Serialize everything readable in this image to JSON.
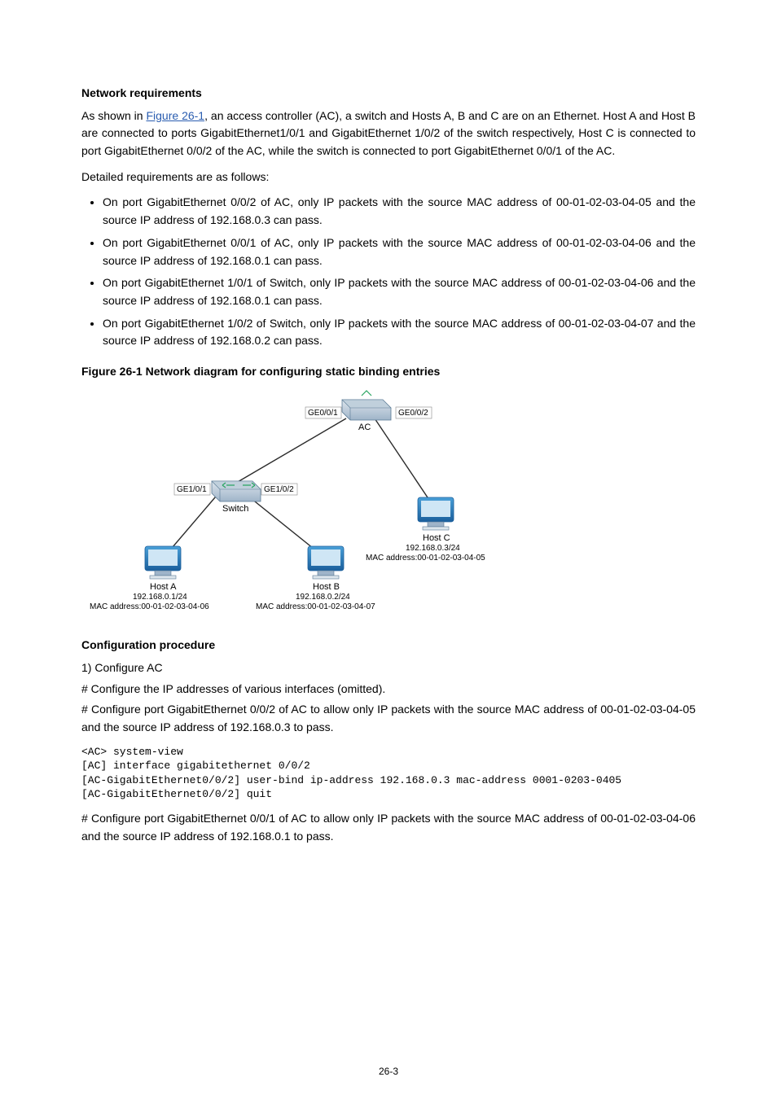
{
  "headings": {
    "network_requirements": "Network requirements",
    "configuration_procedure": "Configuration procedure"
  },
  "intro": {
    "pre_link": "As shown in ",
    "link": "Figure 26-1",
    "post_link": ", an access controller (AC), a switch and Hosts A, B and C are on an Ethernet. Host A and Host B are connected to ports GigabitEthernet1/0/1 and GigabitEthernet 1/0/2 of the switch respectively, Host C is connected to port GigabitEthernet 0/0/2 of the AC, while the switch is connected to port GigabitEthernet 0/0/1 of the AC."
  },
  "detailed_line": "Detailed requirements are as follows:",
  "bullets": [
    "On port GigabitEthernet 0/0/2 of AC, only IP packets with the source MAC address of 00-01-02-03-04-05 and the source IP address of 192.168.0.3 can pass.",
    "On port GigabitEthernet 0/0/1 of AC, only IP packets with the source MAC address of 00-01-02-03-04-06 and the source IP address of 192.168.0.1 can pass.",
    "On port GigabitEthernet 1/0/1 of Switch, only IP packets with the source MAC address of 00-01-02-03-04-06 and the source IP address of 192.168.0.1 can pass.",
    "On port GigabitEthernet 1/0/2 of Switch, only IP packets with the source MAC address of 00-01-02-03-04-07 and the source IP address of 192.168.0.2 can pass."
  ],
  "figure": {
    "caption_prefix": "Figure 26-1",
    "caption_text": " Network diagram for configuring static binding entries",
    "labels": {
      "ge001": "GE0/0/1",
      "ge002": "GE0/0/2",
      "ac": "AC",
      "ge101": "GE1/0/1",
      "ge102": "GE1/0/2",
      "switch": "Switch",
      "hostA_name": "Host A",
      "hostA_ip": "192.168.0.1/24",
      "hostA_mac": "MAC address:00-01-02-03-04-06",
      "hostB_name": "Host B",
      "hostB_ip": "192.168.0.2/24",
      "hostB_mac": "MAC address:00-01-02-03-04-07",
      "hostC_name": "Host C",
      "hostC_ip": "192.168.0.3/24",
      "hostC_mac": "MAC address:00-01-02-03-04-05"
    }
  },
  "procedure": {
    "step1_label": "1)    Configure AC",
    "line1": "# Configure the IP addresses of various interfaces (omitted).",
    "line2": "# Configure port GigabitEthernet 0/0/2 of AC to allow only IP packets with the source MAC address of 00-01-02-03-04-05 and the source IP address of 192.168.0.3 to pass.",
    "cmd1": "<AC> system-view\n[AC] interface gigabitethernet 0/0/2\n[AC-GigabitEthernet0/0/2] user-bind ip-address 192.168.0.3 mac-address 0001-0203-0405\n[AC-GigabitEthernet0/0/2] quit",
    "line3": "# Configure port GigabitEthernet 0/0/1 of AC to allow only IP packets with the source MAC address of 00-01-02-03-04-06 and the source IP address of 192.168.0.1 to pass."
  },
  "page_number": "26-3"
}
